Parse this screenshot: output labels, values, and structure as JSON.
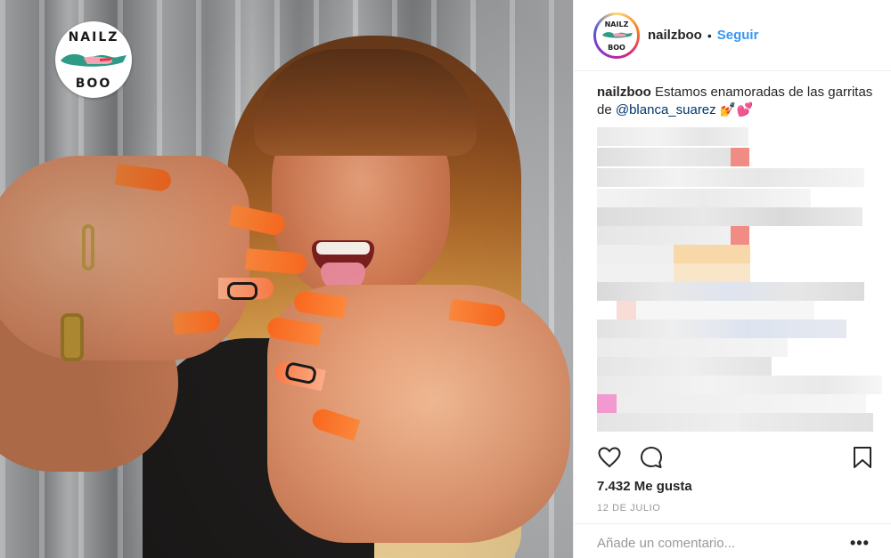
{
  "post": {
    "image_logo": {
      "line1": "NAILZ",
      "line2": "BOO"
    }
  },
  "header": {
    "avatar_text": {
      "line1": "NAILZ",
      "line2": "BOO"
    },
    "username": "nailzboo",
    "separator": "•",
    "follow_label": "Seguir"
  },
  "caption": {
    "username": "nailzboo",
    "text": " Estamos enamoradas de las garritas de ",
    "mention": "@blanca_suarez",
    "emoji": " 💅💕"
  },
  "actions": {
    "icons": [
      "heart-icon",
      "comment-icon",
      "bookmark-icon"
    ]
  },
  "likes": "7.432 Me gusta",
  "date": "12 DE JULIO",
  "comment_placeholder": "Añade un comentario...",
  "more_label": "•••",
  "colors": {
    "accent": "#3897f0",
    "text": "#262626",
    "muted": "#999999"
  }
}
